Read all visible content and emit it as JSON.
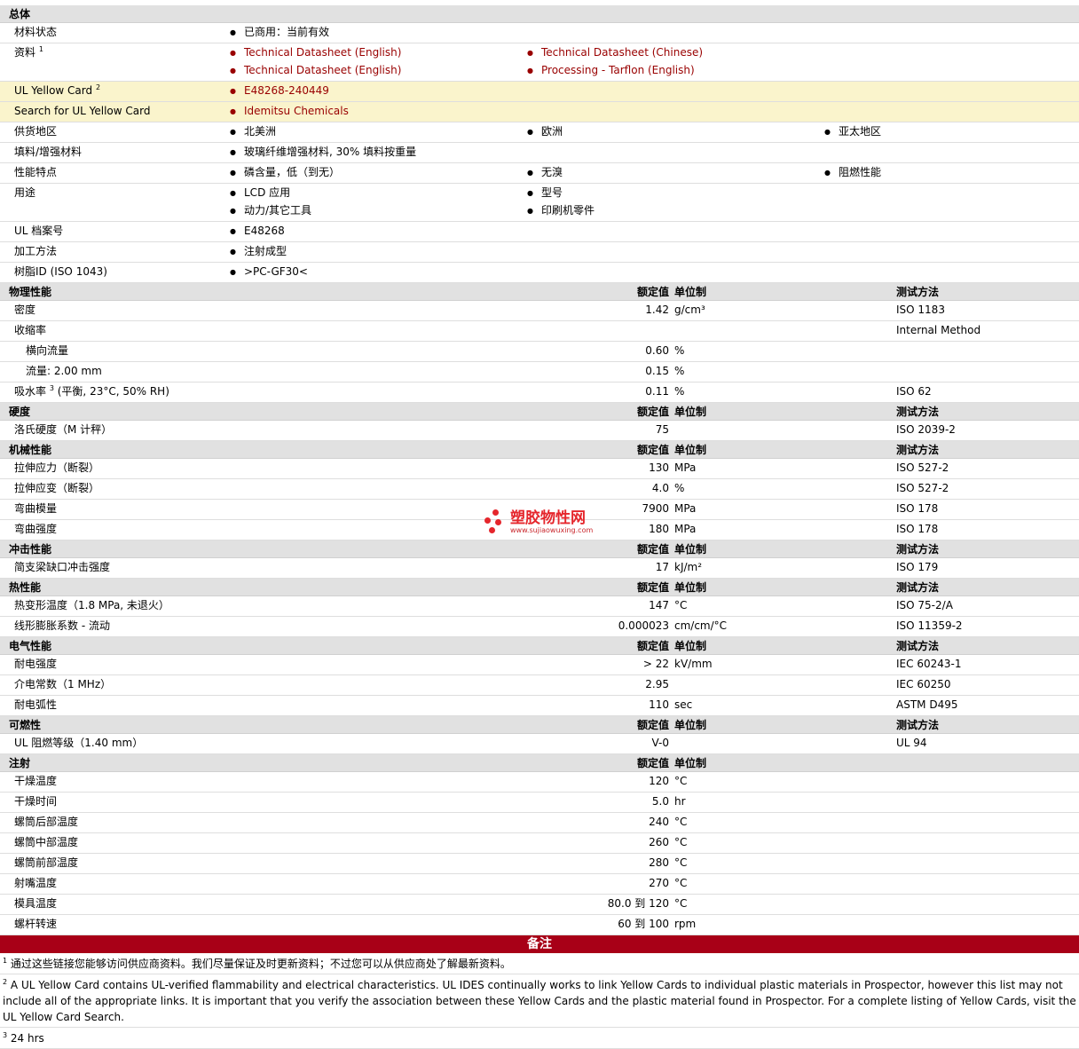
{
  "general": {
    "title": "总体",
    "rows": {
      "material_status": {
        "label": "材料状态",
        "values": [
          "已商用：当前有效"
        ]
      },
      "literature": {
        "label": "资料",
        "sup": "1",
        "links": [
          "Technical Datasheet (English)",
          "Technical Datasheet (Chinese)",
          "Technical Datasheet (English)",
          "Processing - Tarflon (English)"
        ]
      },
      "ul_yellow_card": {
        "label": "UL Yellow Card",
        "sup": "2",
        "link": "E48268-240449"
      },
      "search_ul": {
        "label": "Search for UL Yellow Card",
        "link": "Idemitsu Chemicals"
      },
      "availability": {
        "label": "供货地区",
        "values": [
          "北美洲",
          "欧洲",
          "亚太地区"
        ]
      },
      "filler": {
        "label": "填料/增强材料",
        "values": [
          "玻璃纤维增强材料, 30% 填料按重量"
        ]
      },
      "features": {
        "label": "性能特点",
        "values": [
          "磷含量，低（到无）",
          "无溴",
          "阻燃性能"
        ]
      },
      "uses": {
        "label": "用途",
        "values": [
          "LCD 应用",
          "型号",
          "动力/其它工具",
          "印刷机零件"
        ]
      },
      "ul_file": {
        "label": "UL 档案号",
        "values": [
          "E48268"
        ]
      },
      "processing": {
        "label": "加工方法",
        "values": [
          "注射成型"
        ]
      },
      "resin_id": {
        "label": "树脂ID (ISO 1043)",
        "values": [
          ">PC-GF30<"
        ]
      }
    }
  },
  "col_headers": {
    "nominal": "额定值",
    "unit": "单位制",
    "test": "测试方法"
  },
  "sections": [
    {
      "title": "物理性能",
      "show_test": true,
      "rows": [
        {
          "label": "密度",
          "nominal": "1.42",
          "unit": "g/cm³",
          "test": "ISO 1183"
        },
        {
          "label": "收缩率",
          "nominal": "",
          "unit": "",
          "test": "Internal Method"
        },
        {
          "label": "横向流量",
          "nominal": "0.60",
          "unit": "%",
          "test": "",
          "indent": true
        },
        {
          "label": "流量: 2.00 mm",
          "nominal": "0.15",
          "unit": "%",
          "test": "",
          "indent": true
        },
        {
          "label": "吸水率",
          "sup": "3",
          "label_suffix": " (平衡, 23°C, 50% RH)",
          "nominal": "0.11",
          "unit": "%",
          "test": "ISO 62"
        }
      ]
    },
    {
      "title": "硬度",
      "show_test": true,
      "rows": [
        {
          "label": "洛氏硬度（M 计秤）",
          "nominal": "75",
          "unit": "",
          "test": "ISO 2039-2"
        }
      ]
    },
    {
      "title": "机械性能",
      "show_test": true,
      "rows": [
        {
          "label": "拉伸应力（断裂）",
          "nominal": "130",
          "unit": "MPa",
          "test": "ISO 527-2"
        },
        {
          "label": "拉伸应变（断裂）",
          "nominal": "4.0",
          "unit": "%",
          "test": "ISO 527-2"
        },
        {
          "label": "弯曲模量",
          "nominal": "7900",
          "unit": "MPa",
          "test": "ISO 178"
        },
        {
          "label": "弯曲强度",
          "nominal": "180",
          "unit": "MPa",
          "test": "ISO 178"
        }
      ]
    },
    {
      "title": "冲击性能",
      "show_test": true,
      "rows": [
        {
          "label": "简支梁缺口冲击强度",
          "nominal": "17",
          "unit": "kJ/m²",
          "test": "ISO 179"
        }
      ]
    },
    {
      "title": "热性能",
      "show_test": true,
      "rows": [
        {
          "label": "热变形温度（1.8 MPa, 未退火）",
          "nominal": "147",
          "unit": "°C",
          "test": "ISO 75-2/A"
        },
        {
          "label": "线形膨胀系数 - 流动",
          "nominal": "0.000023",
          "unit": "cm/cm/°C",
          "test": "ISO 11359-2"
        }
      ]
    },
    {
      "title": "电气性能",
      "show_test": true,
      "rows": [
        {
          "label": "耐电强度",
          "nominal": "> 22",
          "unit": "kV/mm",
          "test": "IEC 60243-1"
        },
        {
          "label": "介电常数（1 MHz）",
          "nominal": "2.95",
          "unit": "",
          "test": "IEC 60250"
        },
        {
          "label": "耐电弧性",
          "nominal": "110",
          "unit": "sec",
          "test": "ASTM D495"
        }
      ]
    },
    {
      "title": "可燃性",
      "show_test": true,
      "rows": [
        {
          "label": "UL 阻燃等级（1.40 mm）",
          "nominal": "V-0",
          "unit": "",
          "test": "UL 94"
        }
      ]
    },
    {
      "title": "注射",
      "show_test": false,
      "rows": [
        {
          "label": "干燥温度",
          "nominal": "120",
          "unit": "°C",
          "test": ""
        },
        {
          "label": "干燥时间",
          "nominal": "5.0",
          "unit": "hr",
          "test": ""
        },
        {
          "label": "螺筒后部温度",
          "nominal": "240",
          "unit": "°C",
          "test": ""
        },
        {
          "label": "螺筒中部温度",
          "nominal": "260",
          "unit": "°C",
          "test": ""
        },
        {
          "label": "螺筒前部温度",
          "nominal": "280",
          "unit": "°C",
          "test": ""
        },
        {
          "label": "射嘴温度",
          "nominal": "270",
          "unit": "°C",
          "test": ""
        },
        {
          "label": "模具温度",
          "nominal": "80.0 到  120",
          "unit": "°C",
          "test": ""
        },
        {
          "label": "螺杆转速",
          "nominal": "60 到  100",
          "unit": "rpm",
          "test": ""
        }
      ]
    }
  ],
  "notes": {
    "title": "备注",
    "items": [
      {
        "num": "1",
        "text": "通过这些链接您能够访问供应商资料。我们尽量保证及时更新资料；不过您可以从供应商处了解最新资料。"
      },
      {
        "num": "2",
        "text": "A UL Yellow Card contains UL-verified flammability and electrical characteristics. UL IDES continually works to link Yellow Cards to individual plastic materials in Prospector, however this list may not include all of the appropriate links. It is important that you verify the association between these Yellow Cards and the plastic material found in Prospector. For a complete listing of Yellow Cards, visit the UL Yellow Card Search."
      },
      {
        "num": "3",
        "text": "24 hrs"
      }
    ]
  },
  "watermark": {
    "name": "塑胶物性网",
    "url": "www.sujiaowuxing.com"
  },
  "colors": {
    "link": "#990000",
    "notes_bar": "#a80017",
    "section_bg": "#e1e1e1",
    "highlight_bg": "#faf4cc",
    "watermark": "#e5262c"
  }
}
